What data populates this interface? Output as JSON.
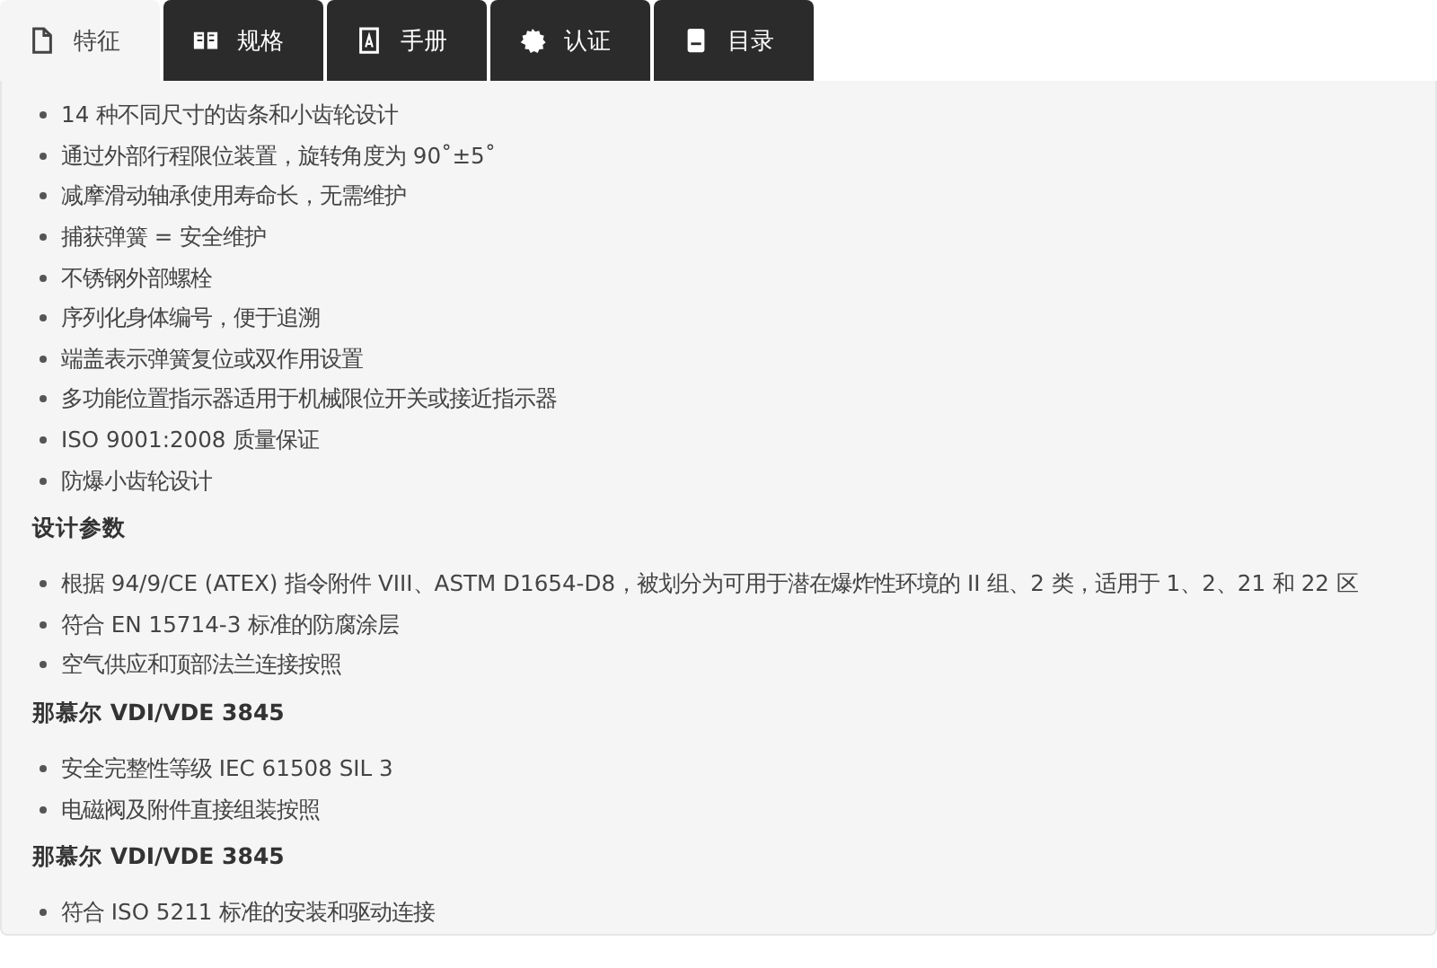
{
  "tabs": [
    {
      "label": "特征",
      "selected": true
    },
    {
      "label": "规格",
      "selected": false
    },
    {
      "label": "手册",
      "selected": false
    },
    {
      "label": "认证",
      "selected": false
    },
    {
      "label": "目录",
      "selected": false
    }
  ],
  "blocks": [
    {
      "kind": "list",
      "items": [
        "14 种不同尺寸的齿条和小齿轮设计",
        "通过外部行程限位装置，旋转角度为 90˚±5˚",
        "减摩滑动轴承使用寿命长，无需维护",
        "捕获弹簧 = 安全维护",
        "不锈钢外部螺栓",
        "序列化身体编号，便于追溯",
        "端盖表示弹簧复位或双作用设置",
        "多功能位置指示器适用于机械限位开关或接近指示器",
        "ISO 9001:2008 质量保证",
        "防爆小齿轮设计"
      ]
    },
    {
      "kind": "heading",
      "text": "设计参数"
    },
    {
      "kind": "list",
      "items": [
        "根据 94/9/CE (ATEX) 指令附件 VIII、ASTM D1654-D8，被划分为可用于潜在爆炸性环境的 II 组、2 类，适用于 1、2、21 和 22 区",
        "符合 EN 15714-3 标准的防腐涂层",
        "空气供应和顶部法兰连接按照"
      ]
    },
    {
      "kind": "heading",
      "text": "那慕尔 VDI/VDE 3845"
    },
    {
      "kind": "list",
      "items": [
        "安全完整性等级 IEC 61508 SIL 3",
        "电磁阀及附件直接组装按照"
      ]
    },
    {
      "kind": "heading",
      "text": "那慕尔 VDI/VDE 3845"
    },
    {
      "kind": "list",
      "items": [
        "符合 ISO 5211 标准的安装和驱动连接"
      ]
    }
  ]
}
